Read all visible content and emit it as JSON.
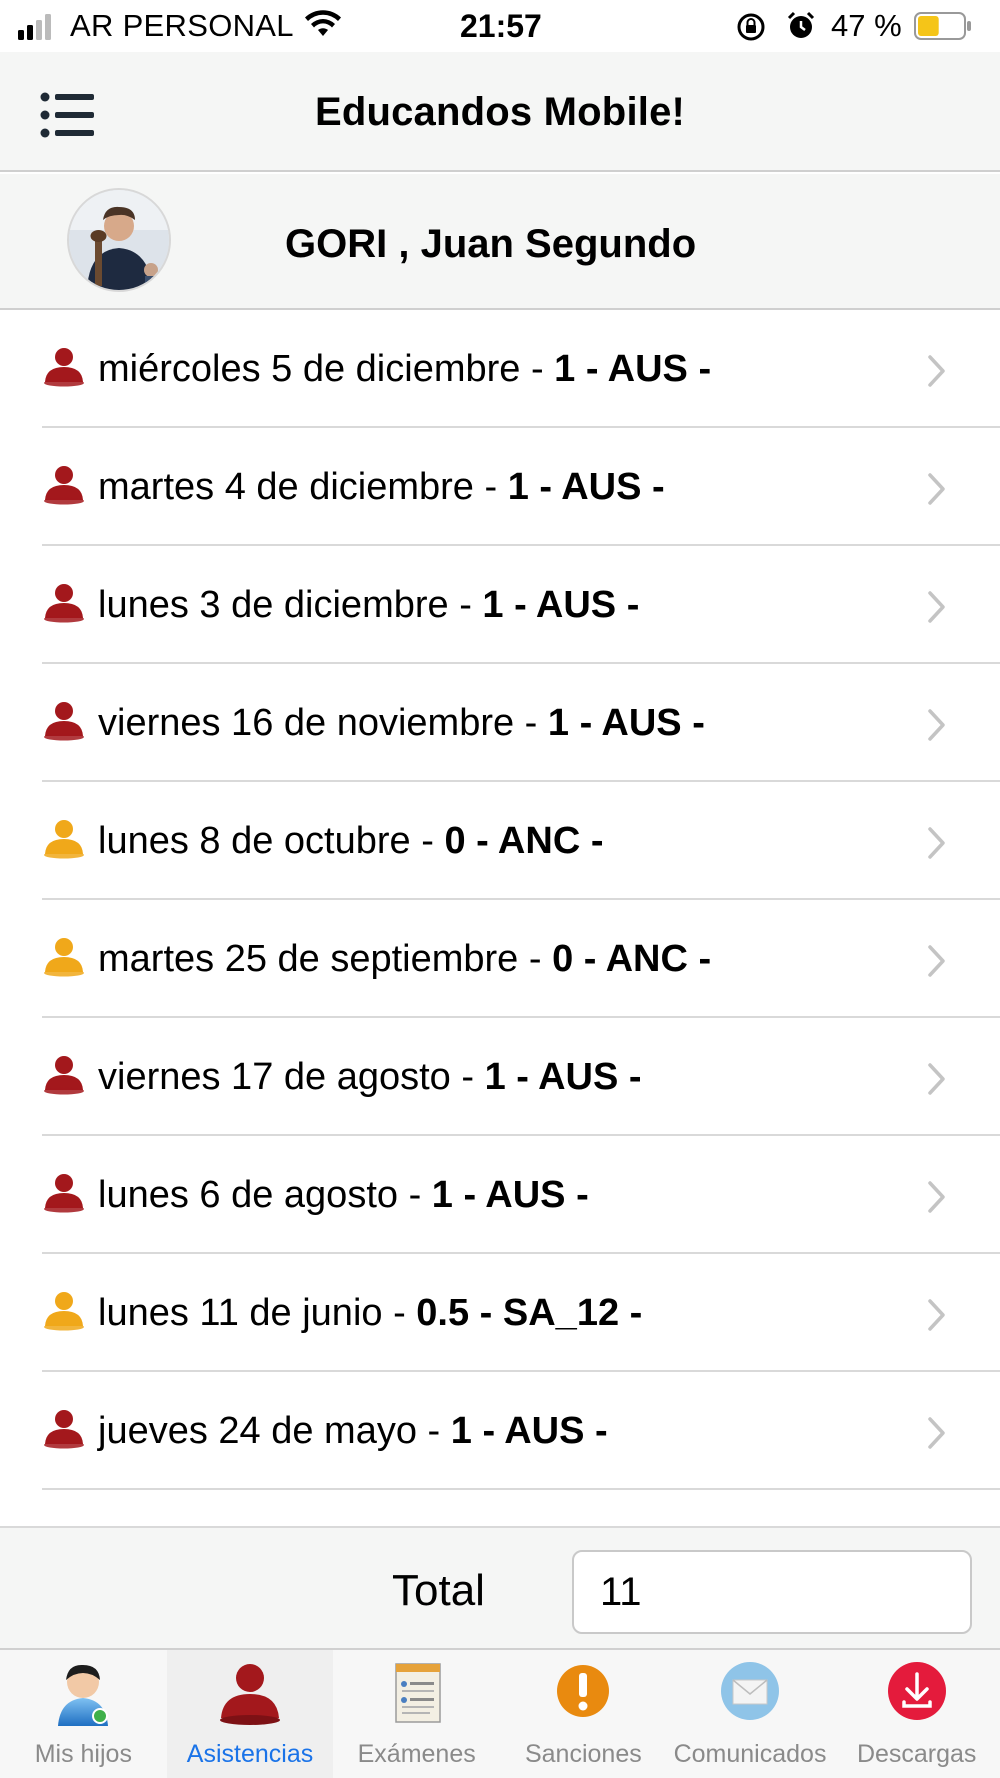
{
  "status_bar": {
    "carrier": "AR PERSONAL",
    "time": "21:57",
    "battery_percent": "47 %",
    "battery_level": 0.47,
    "battery_color": "#f5c518"
  },
  "header": {
    "title": "Educandos Mobile!",
    "menu_icon": "list-icon"
  },
  "profile": {
    "name": "GORI , Juan Segundo"
  },
  "colors": {
    "absent": "#a3181c",
    "late": "#f0a81a",
    "active_tab": "#1a73e8",
    "inactive_tab": "#8a8a8a"
  },
  "attendance": [
    {
      "date": "miércoles 5 de diciembre - ",
      "detail": "1 - AUS -",
      "status": "absent"
    },
    {
      "date": "martes 4 de diciembre - ",
      "detail": "1 - AUS -",
      "status": "absent"
    },
    {
      "date": "lunes 3 de diciembre - ",
      "detail": "1 - AUS -",
      "status": "absent"
    },
    {
      "date": "viernes 16 de noviembre - ",
      "detail": "1 - AUS -",
      "status": "absent"
    },
    {
      "date": "lunes 8 de octubre - ",
      "detail": "0 - ANC -",
      "status": "late"
    },
    {
      "date": "martes 25 de septiembre - ",
      "detail": "0 - ANC -",
      "status": "late"
    },
    {
      "date": "viernes 17 de agosto - ",
      "detail": "1 - AUS -",
      "status": "absent"
    },
    {
      "date": "lunes 6 de agosto - ",
      "detail": "1 - AUS -",
      "status": "absent"
    },
    {
      "date": "lunes 11 de junio - ",
      "detail": "0.5 - SA_12 -",
      "status": "late"
    },
    {
      "date": "jueves 24 de mayo - ",
      "detail": "1 - AUS -",
      "status": "absent"
    }
  ],
  "total": {
    "label": "Total",
    "value": "11"
  },
  "tabs": [
    {
      "label": "Mis hijos",
      "icon": "user-avatar-icon",
      "active": false
    },
    {
      "label": "Asistencias",
      "icon": "person-icon",
      "active": true
    },
    {
      "label": "Exámenes",
      "icon": "report-document-icon",
      "active": false
    },
    {
      "label": "Sanciones",
      "icon": "exclamation-icon",
      "active": false
    },
    {
      "label": "Comunicados",
      "icon": "envelope-icon",
      "active": false
    },
    {
      "label": "Descargas",
      "icon": "download-icon",
      "active": false
    }
  ]
}
